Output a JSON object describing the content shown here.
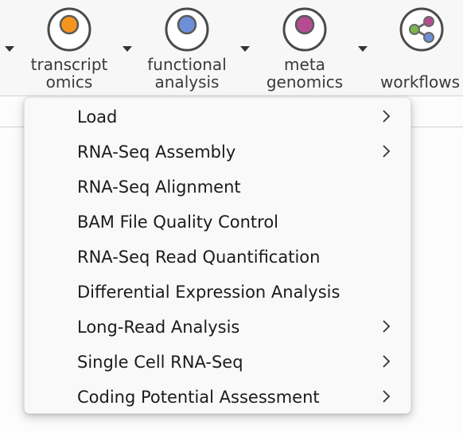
{
  "toolbar": {
    "tools": [
      {
        "label_line1": "transcript",
        "label_line2": "omics",
        "icon": "transcriptomics-icon",
        "dot_color": "#f7941d"
      },
      {
        "label_line1": "functional",
        "label_line2": "analysis",
        "icon": "functional-analysis-icon",
        "dot_color": "#6e8fd8"
      },
      {
        "label_line1": "meta",
        "label_line2": "genomics",
        "icon": "metagenomics-icon",
        "dot_color": "#b54c92"
      },
      {
        "label_line1": "workflows",
        "label_line2": "",
        "icon": "workflows-icon",
        "dot_color": "#7ab648"
      }
    ],
    "dropdown_icon": "caret-down-icon"
  },
  "menu": {
    "items": [
      {
        "label": "Load",
        "has_submenu": true
      },
      {
        "label": "RNA-Seq Assembly",
        "has_submenu": true
      },
      {
        "label": "RNA-Seq Alignment",
        "has_submenu": false
      },
      {
        "label": "BAM File Quality Control",
        "has_submenu": false
      },
      {
        "label": "RNA-Seq Read Quantification",
        "has_submenu": false
      },
      {
        "label": "Differential Expression Analysis",
        "has_submenu": false
      },
      {
        "label": "Long-Read Analysis",
        "has_submenu": true
      },
      {
        "label": "Single Cell RNA-Seq",
        "has_submenu": true
      },
      {
        "label": "Coding Potential Assessment",
        "has_submenu": true
      }
    ],
    "submenu_icon": "chevron-right-icon"
  },
  "colors": {
    "toolbar_bg": "#f7f7f7",
    "menu_bg": "#f9f9f9",
    "text": "#1b1b1b",
    "icon_ring": "#4a4a4a"
  }
}
